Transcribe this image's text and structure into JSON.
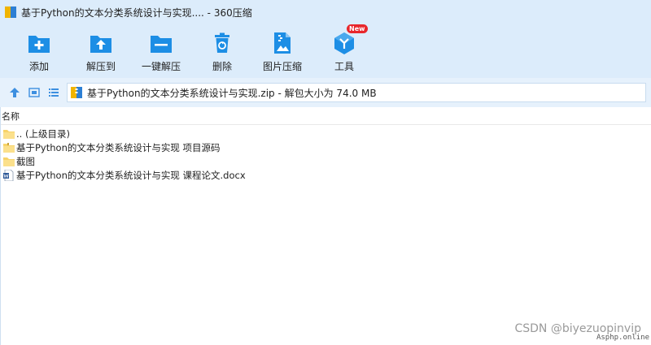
{
  "window": {
    "title": "基于Python的文本分类系统设计与实现.... - 360压缩"
  },
  "toolbar": {
    "items": [
      {
        "label": "添加",
        "icon": "add-icon"
      },
      {
        "label": "解压到",
        "icon": "extract-to-icon"
      },
      {
        "label": "一键解压",
        "icon": "one-click-extract-icon"
      },
      {
        "label": "删除",
        "icon": "recycle-bin-icon"
      },
      {
        "label": "图片压缩",
        "icon": "image-compress-icon"
      },
      {
        "label": "工具",
        "icon": "tools-cube-icon",
        "badge": "New"
      }
    ]
  },
  "navbar": {
    "path_text": "基于Python的文本分类系统设计与实现.zip - 解包大小为 74.0 MB"
  },
  "list": {
    "header_name": "名称",
    "rows": [
      {
        "name": ".. (上级目录)",
        "type": "folder"
      },
      {
        "name": "基于Python的文本分类系统设计与实现 项目源码",
        "type": "folder"
      },
      {
        "name": "截图",
        "type": "folder"
      },
      {
        "name": "基于Python的文本分类系统设计与实现 课程论文.docx",
        "type": "docx"
      }
    ]
  },
  "watermark": {
    "csdn": "CSDN @biyezuopinvip",
    "site": "Asphp.online"
  },
  "colors": {
    "toolbar_bg": "#dcecfb",
    "accent_blue": "#1d8ee5",
    "folder_yellow": "#f7d36a",
    "badge_red": "#e8262b"
  }
}
